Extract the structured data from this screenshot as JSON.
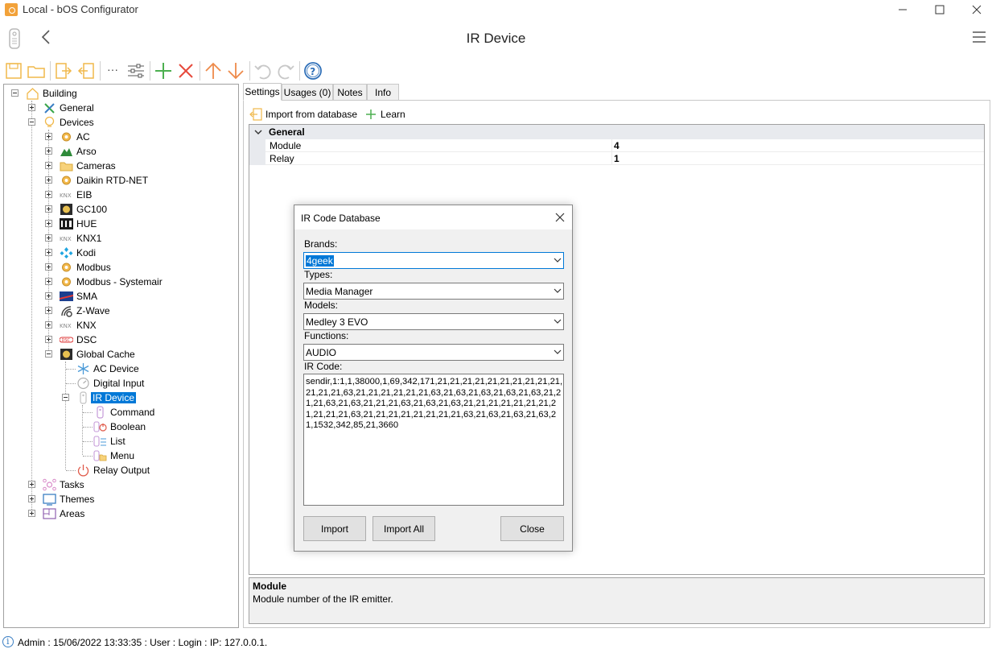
{
  "window": {
    "title": "Local - bOS Configurator"
  },
  "header": {
    "title": "IR Device"
  },
  "toolbar": {
    "icons": [
      "save-icon",
      "open-folder-icon",
      "import-icon",
      "export-icon",
      "more-icon",
      "properties-icon",
      "add-icon",
      "delete-icon",
      "move-up-icon",
      "move-down-icon",
      "undo-icon",
      "redo-icon",
      "help-icon"
    ],
    "more_label": "···"
  },
  "tree": {
    "root": "Building",
    "general": "General",
    "devices": "Devices",
    "device_items": [
      "AC",
      "Arso",
      "Cameras",
      "Daikin RTD-NET",
      "EIB",
      "GC100",
      "HUE",
      "KNX1",
      "Kodi",
      "Modbus",
      "Modbus - Systemair",
      "SMA",
      "Z-Wave",
      "KNX",
      "DSC"
    ],
    "global_cache": "Global Cache",
    "gc_items": [
      "AC Device",
      "Digital Input"
    ],
    "ir_device": "IR Device",
    "ir_items": [
      "Command",
      "Boolean",
      "List",
      "Menu"
    ],
    "relay_output": "Relay Output",
    "tasks": "Tasks",
    "themes": "Themes",
    "areas": "Areas"
  },
  "tabs": [
    "Settings",
    "Usages (0)",
    "Notes",
    "Info"
  ],
  "actions": {
    "import_db": "Import from database",
    "learn": "Learn"
  },
  "properties": {
    "category": "General",
    "rows": [
      {
        "name": "Module",
        "value": "4"
      },
      {
        "name": "Relay",
        "value": "1"
      }
    ]
  },
  "help": {
    "title": "Module",
    "description": "Module number of the IR emitter."
  },
  "status": {
    "text": "Admin : 15/06/2022 13:33:35 : User : Login : IP: 127.0.0.1."
  },
  "dialog": {
    "title": "IR Code Database",
    "brands_label": "Brands:",
    "brands_value": "4geek",
    "types_label": "Types:",
    "types_value": "Media Manager",
    "models_label": "Models:",
    "models_value": "Medley 3 EVO",
    "functions_label": "Functions:",
    "functions_value": "AUDIO",
    "ircode_label": "IR Code:",
    "ircode_value": "sendir,1:1,1,38000,1,69,342,171,21,21,21,21,21,21,21,21,21,21,21,21,21,63,21,21,21,21,21,21,63,21,63,21,63,21,63,21,63,21,21,21,63,21,63,21,21,21,63,21,63,21,63,21,21,21,21,21,21,21,21,21,21,21,63,21,21,21,21,21,21,21,21,63,21,63,21,63,21,63,21,1532,342,85,21,3660",
    "import_label": "Import",
    "import_all_label": "Import All",
    "close_label": "Close"
  }
}
